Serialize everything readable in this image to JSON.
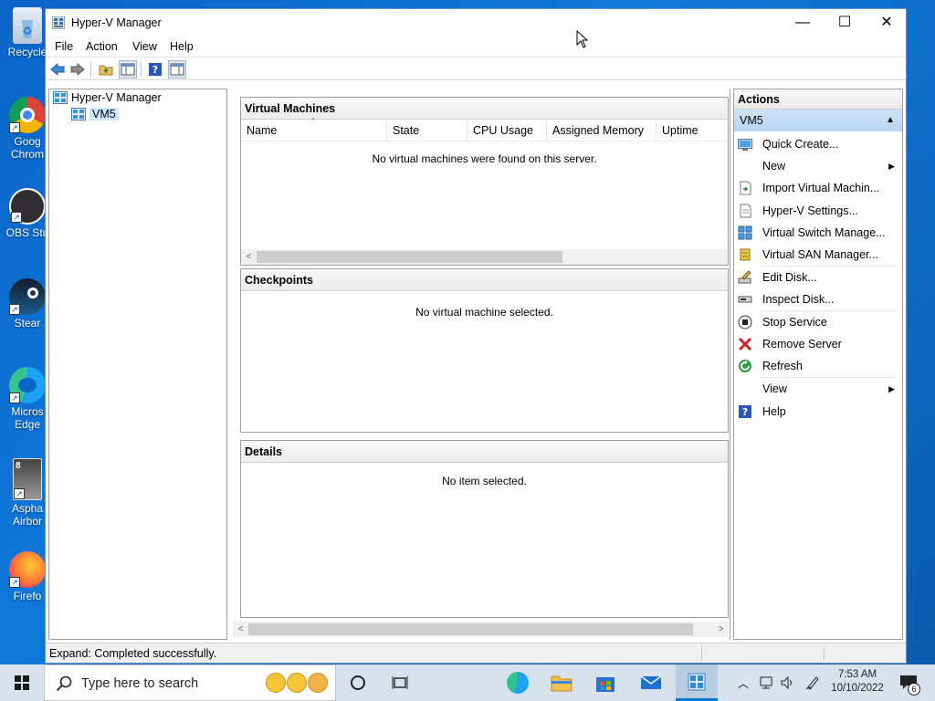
{
  "desktop": {
    "icons": [
      {
        "label": "Recycle"
      },
      {
        "label": "Goog\nChrom"
      },
      {
        "label": "OBS Stu"
      },
      {
        "label": "Stear"
      },
      {
        "label": "Micros\nEdge"
      },
      {
        "label": "Aspha\nAirbor"
      },
      {
        "label": "Firefo"
      }
    ]
  },
  "window": {
    "title": "Hyper-V Manager",
    "controls": {
      "minimize": "—",
      "maximize": "☐",
      "close": "✕"
    },
    "menu": [
      "File",
      "Action",
      "View",
      "Help"
    ]
  },
  "tree": {
    "root": "Hyper-V Manager",
    "child": "VM5"
  },
  "panels": {
    "vms": {
      "title": "Virtual Machines",
      "columns": [
        "Name",
        "State",
        "CPU Usage",
        "Assigned Memory",
        "Uptime"
      ],
      "empty": "No virtual machines were found on this server."
    },
    "checkpoints": {
      "title": "Checkpoints",
      "empty": "No virtual machine selected."
    },
    "details": {
      "title": "Details",
      "empty": "No item selected."
    }
  },
  "actions": {
    "header": "Actions",
    "group": "VM5",
    "items": [
      {
        "label": "Quick Create...",
        "icon": "quick-create-icon"
      },
      {
        "label": "New",
        "icon": "",
        "submenu": "▶"
      },
      {
        "label": "Import Virtual Machin...",
        "icon": "import-icon"
      },
      {
        "label": "Hyper-V Settings...",
        "icon": "settings-icon"
      },
      {
        "label": "Virtual Switch Manage...",
        "icon": "switch-icon"
      },
      {
        "label": "Virtual SAN Manager...",
        "icon": "san-icon"
      },
      {
        "label": "Edit Disk...",
        "icon": "edit-disk-icon"
      },
      {
        "label": "Inspect Disk...",
        "icon": "inspect-disk-icon"
      },
      {
        "label": "Stop Service",
        "icon": "stop-icon"
      },
      {
        "label": "Remove Server",
        "icon": "remove-icon"
      },
      {
        "label": "Refresh",
        "icon": "refresh-icon"
      },
      {
        "label": "View",
        "icon": "",
        "submenu": "▶"
      },
      {
        "label": "Help",
        "icon": "help-icon"
      }
    ]
  },
  "status": {
    "text": "Expand:  Completed successfully."
  },
  "taskbar": {
    "search_placeholder": "Type here to search",
    "time": "7:53 AM",
    "date": "10/10/2022",
    "notification_count": "6"
  },
  "colors": {
    "accent": "#0078d7",
    "selection": "#cce8ff",
    "remove": "#d42020",
    "refresh": "#2a9d3a"
  }
}
